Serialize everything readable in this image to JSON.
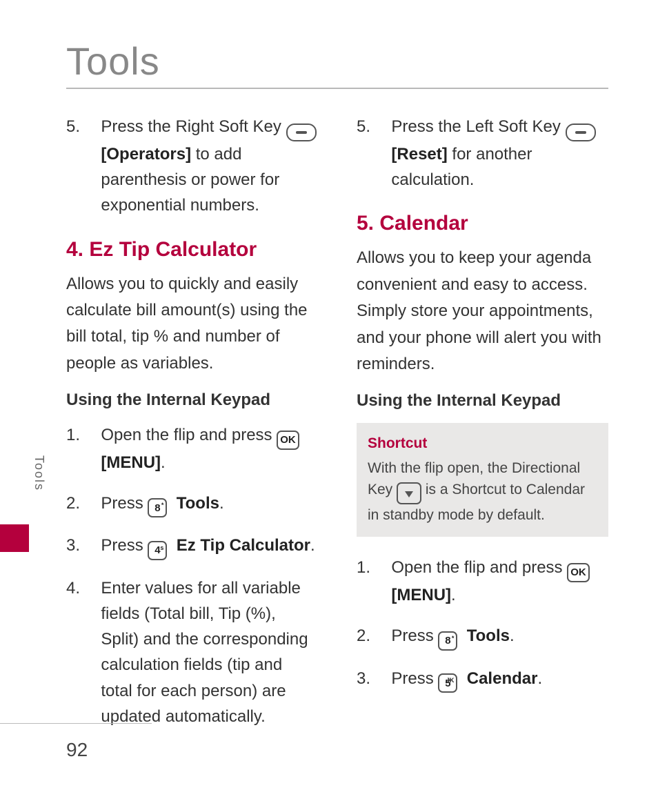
{
  "page_title": "Tools",
  "side_tab": "Tools",
  "page_number": "92",
  "left": {
    "top_step": {
      "num": "5.",
      "pre": "Press the Right Soft Key ",
      "bold": "[Operators]",
      "post": " to add parenthesis or power for exponential numbers."
    },
    "section_heading": "4. Ez Tip Calculator",
    "section_desc": "Allows you to quickly and easily calculate bill amount(s) using the bill total, tip % and number of people as variables.",
    "sub_heading": "Using the Internal Keypad",
    "steps": {
      "s1_num": "1.",
      "s1_text": "Open the flip and press ",
      "s1_bold": "[MENU]",
      "s1_dot": ".",
      "s2_num": "2.",
      "s2_text": "Press ",
      "s2_bold": "Tools",
      "s2_dot": ".",
      "s3_num": "3.",
      "s3_text": "Press ",
      "s3_bold": "Ez Tip Calculator",
      "s3_dot": ".",
      "s4_num": "4.",
      "s4_text": "Enter values for all variable fields (Total bill, Tip (%), Split) and the corresponding calculation fields (tip and total for each person) are updated automatically."
    },
    "keys": {
      "k8": "8",
      "k8sup": "*",
      "k4": "4",
      "k4sup": "s"
    }
  },
  "right": {
    "top_step": {
      "num": "5.",
      "pre": "Press the Left Soft Key ",
      "bold": "[Reset]",
      "post": " for another calculation."
    },
    "section_heading": "5. Calendar",
    "section_desc": "Allows you to keep your agenda convenient and easy to access. Simply store your appointments, and your phone will alert you with reminders.",
    "sub_heading": "Using the Internal Keypad",
    "shortcut": {
      "label": "Shortcut",
      "pre": "With the flip open, the Directional Key ",
      "post": " is a Shortcut to Calendar in standby mode by default."
    },
    "steps": {
      "s1_num": "1.",
      "s1_text": "Open the flip and press ",
      "s1_bold": "[MENU]",
      "s1_dot": ".",
      "s2_num": "2.",
      "s2_text": "Press ",
      "s2_bold": "Tools",
      "s2_dot": ".",
      "s3_num": "3.",
      "s3_text": "Press ",
      "s3_bold": "Calendar",
      "s3_dot": "."
    },
    "keys": {
      "k8": "8",
      "k8sup": "*",
      "k5": "5",
      "k5sup": "JK"
    }
  },
  "ok_label": "OK"
}
